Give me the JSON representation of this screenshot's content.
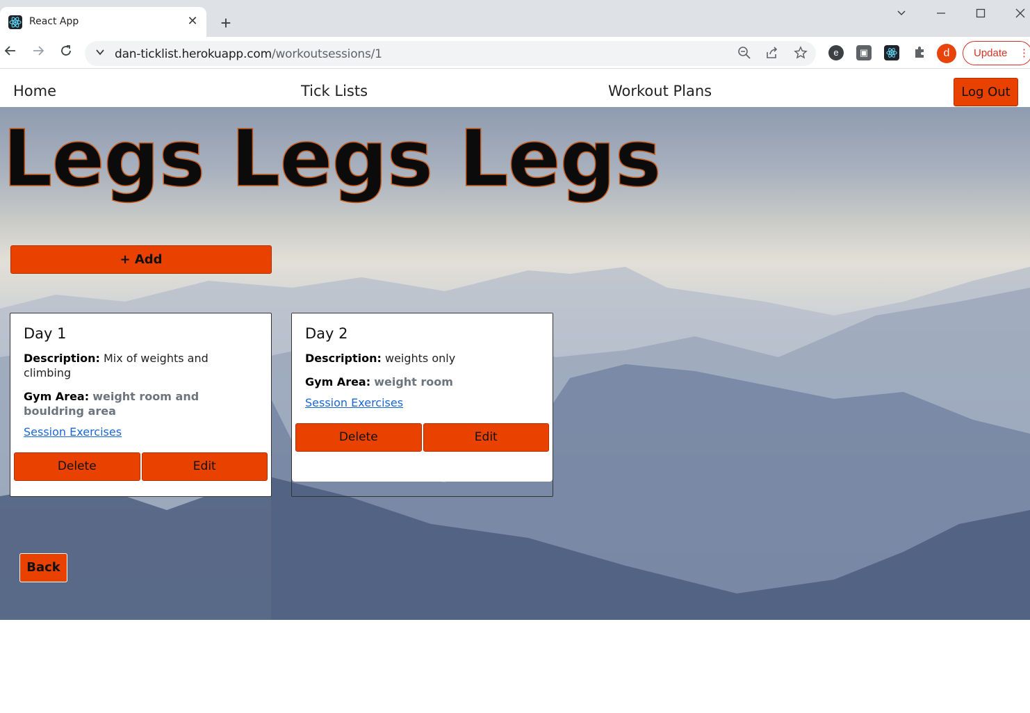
{
  "browser": {
    "tab_title": "React App",
    "tab_close": "✕",
    "new_tab": "+",
    "url_host": "dan-ticklist.herokuapp.com",
    "url_path": "/workoutsessions/1",
    "update_label": "Update",
    "avatar_letter": "d"
  },
  "nav": {
    "home": "Home",
    "tick_lists": "Tick Lists",
    "workout_plans": "Workout Plans",
    "logout": "Log Out"
  },
  "page": {
    "title": "Legs Legs Legs",
    "add_label": "+ Add",
    "back_label": "Back"
  },
  "sessions": [
    {
      "name": "Day 1",
      "description_label": "Description:",
      "description": "Mix of weights and climbing",
      "gym_area_label": "Gym Area:",
      "gym_area": "weight room and bouldring area",
      "link": "Session Exercises",
      "delete_label": "Delete",
      "edit_label": "Edit"
    },
    {
      "name": "Day 2",
      "description_label": "Description:",
      "description": "weights only",
      "gym_area_label": "Gym Area:",
      "gym_area": "weight room",
      "link": "Session Exercises",
      "delete_label": "Delete",
      "edit_label": "Edit"
    }
  ],
  "colors": {
    "accent": "#e84100",
    "link": "#1a66d6"
  }
}
